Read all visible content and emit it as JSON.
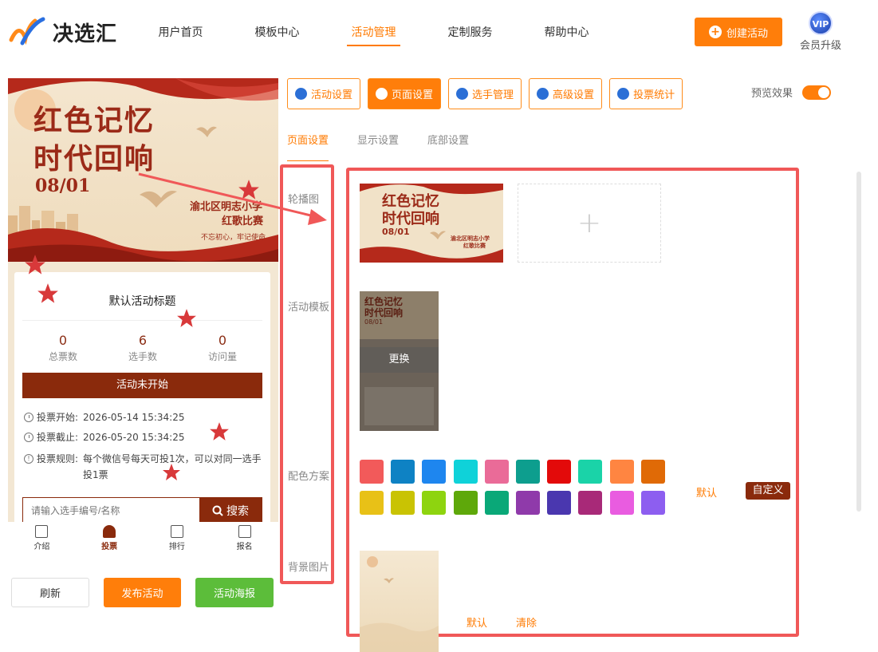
{
  "header": {
    "logo_text": "决选汇",
    "nav": [
      "用户首页",
      "模板中心",
      "活动管理",
      "定制服务",
      "帮助中心"
    ],
    "active_nav": 2,
    "create_label": "创建活动",
    "vip_badge": "VIP",
    "vip_label": "会员升级"
  },
  "poster": {
    "title_line1": "红色记忆",
    "title_line2": "时代回响",
    "date": "08/01",
    "sub_line1": "渝北区明志小学",
    "sub_line2": "红歌比赛",
    "slogan": "不忘初心，牢记使命"
  },
  "card": {
    "title": "默认活动标题",
    "stats": [
      {
        "value": "0",
        "label": "总票数"
      },
      {
        "value": "6",
        "label": "选手数"
      },
      {
        "value": "0",
        "label": "访问量"
      }
    ],
    "status": "活动未开始",
    "vote_start_label": "投票开始:",
    "vote_start": "2026-05-14 15:34:25",
    "vote_end_label": "投票截止:",
    "vote_end": "2026-05-20 15:34:25",
    "rule_label": "投票规则:",
    "rule_line1": "每个微信号每天可投1次，可以对同一选手",
    "rule_line2": "投1票",
    "search_placeholder": "请输入选手编号/名称",
    "search_button": "搜索"
  },
  "tabbar": [
    "介绍",
    "投票",
    "排行",
    "报名"
  ],
  "bottom_buttons": {
    "refresh": "刷新",
    "publish": "发布活动",
    "poster": "活动海报"
  },
  "top_tabs": [
    "活动设置",
    "页面设置",
    "选手管理",
    "高级设置",
    "投票统计"
  ],
  "active_top_tab": 1,
  "preview_label": "预览效果",
  "sub_tabs": [
    "页面设置",
    "显示设置",
    "底部设置"
  ],
  "side_labels": [
    "轮播图",
    "活动模板",
    "配色方案",
    "背景图片"
  ],
  "replace_label": "更换",
  "colors": {
    "row1": [
      "#f25a5a",
      "#0e82c4",
      "#1e86ef",
      "#0fd2d9",
      "#ea6b98",
      "#0d9e8e",
      "#e30a0a",
      "#1ad3a8",
      "#ff8541",
      "#e06a06"
    ],
    "row2": [
      "#e8c117",
      "#c9c303",
      "#8ed40f",
      "#5ea80a",
      "#0aa878",
      "#8f3aaa",
      "#4a37af",
      "#a82978",
      "#e95ce0",
      "#8d5ef0"
    ],
    "default_label": "默认",
    "custom_label": "自定义"
  },
  "background": {
    "default_label": "默认",
    "clear_label": "清除"
  }
}
